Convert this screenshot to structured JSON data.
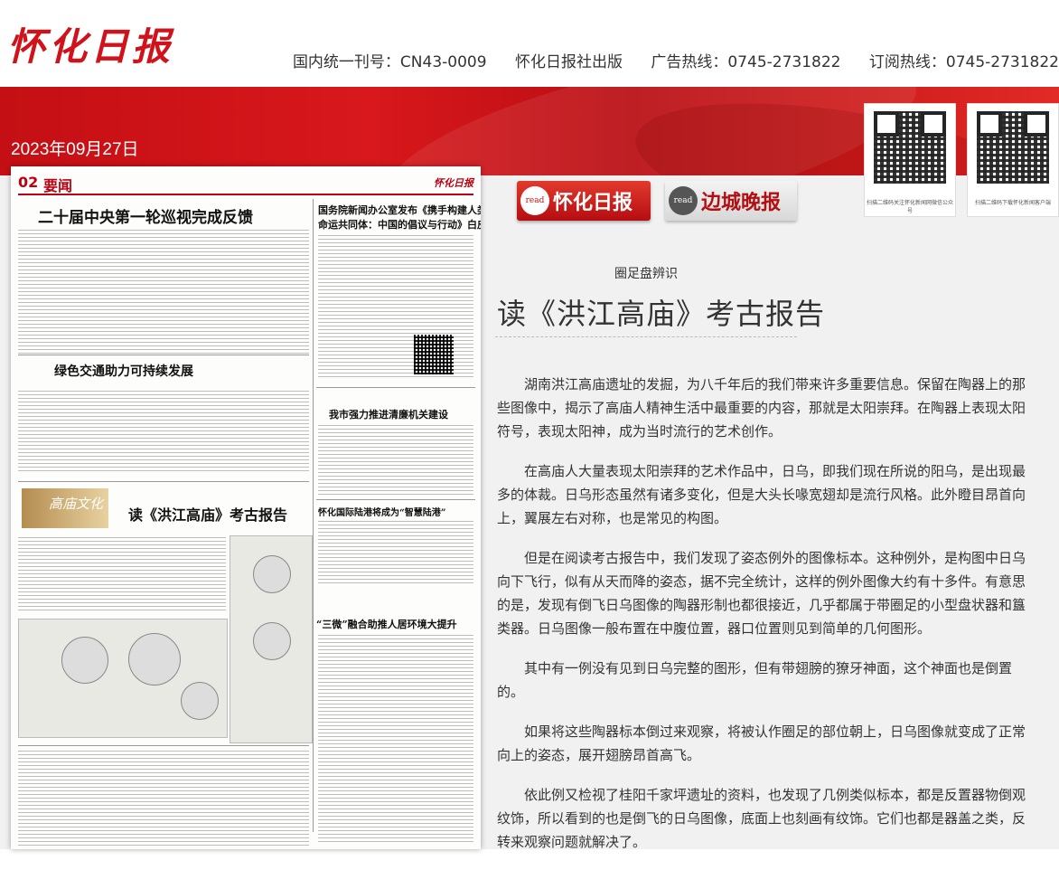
{
  "header": {
    "logo_text": "怀化日报",
    "issn": "国内统一刊号：CN43-0009",
    "publisher": "怀化日报社出版",
    "ad_hotline": "广告热线：0745-2731822",
    "subscribe_hotline": "订阅热线：0745-2731822"
  },
  "date": "2023年09月27日",
  "qr_codes": [
    {
      "label": "扫描二维码关注怀化新闻网微信公众号"
    },
    {
      "label": "扫描二维码下载怀化新闻客户端"
    }
  ],
  "tabs": [
    {
      "icon": "read",
      "label": "怀化日报"
    },
    {
      "icon": "read",
      "label": "边城晚报"
    }
  ],
  "page": {
    "number": "02",
    "section": "要闻",
    "masthead": "怀化日报",
    "headlines": [
      "二十届中央第一轮巡视完成反馈",
      "国务院新闻办公室发布《携手构建人类",
      "命运共同体：中国的倡议与行动》白皮书",
      "绿色交通助力可持续发展",
      "我市强力推进清廉机关建设",
      "怀化国际陆港将成为“智慧陆港”",
      "读《洪江高庙》考古报告",
      "“三微”融合助推人居环境大提升"
    ],
    "banner": "高庙文化"
  },
  "article": {
    "kicker": "圈足盘辨识",
    "title": "读《洪江高庙》考古报告",
    "paragraphs": [
      "湖南洪江高庙遗址的发掘，为八千年后的我们带来许多重要信息。保留在陶器上的那些图像中，揭示了高庙人精神生活中最重要的内容，那就是太阳崇拜。在陶器上表现太阳符号，表现太阳神，成为当时流行的艺术创作。",
      "在高庙人大量表现太阳崇拜的艺术作品中，日乌，即我们现在所说的阳乌，是出现最多的体裁。日乌形态虽然有诸多变化，但是大头长喙宽翅却是流行风格。此外瞪目昂首向上，翼展左右对称，也是常见的构图。",
      "但是在阅读考古报告中，我们发现了姿态例外的图像标本。这种例外，是构图中日乌向下飞行，似有从天而降的姿态，据不完全统计，这样的例外图像大约有十多件。有意思的是，发现有倒飞日乌图像的陶器形制也都很接近，几乎都属于带圈足的小型盘状器和簋类器。日乌图像一般布置在中腹位置，器口位置则见到简单的几何图形。",
      "其中有一例没有见到日乌完整的图形，但有带翅膀的獠牙神面，这个神面也是倒置的。",
      "如果将这些陶器标本倒过来观察，将被认作圈足的部位朝上，日乌图像就变成了正常向上的姿态，展开翅膀昂首高飞。",
      "依此例又检视了桂阳千家坪遗址的资料，也发现了几例类似标本，都是反置器物倒观纹饰，所以看到的也是倒飞的日乌图像，底面上也刻画有纹饰。它们也都是器盖之类，反转来观察问题就解决了。"
    ]
  },
  "colors": {
    "brand_red": "#d0121b",
    "band_red": "#c40f14"
  }
}
